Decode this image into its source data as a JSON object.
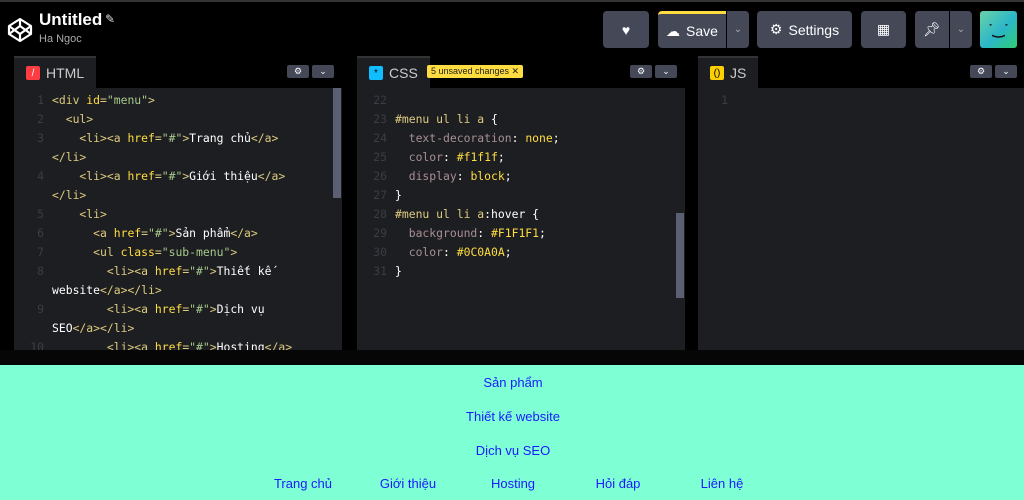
{
  "header": {
    "title": "Untitled",
    "author": "Ha Ngoc",
    "save_label": "Save",
    "settings_label": "Settings"
  },
  "icons": {
    "logo": "codepen-logo",
    "edit": "pencil-icon",
    "like": "heart-icon",
    "save": "cloud-icon",
    "settings": "gear-icon",
    "layout": "layout-icon",
    "pin": "pin-icon",
    "dropdown": "chevron-down-icon"
  },
  "colors": {
    "accent": "#ffdd40",
    "html": "#ff3c41",
    "css": "#0ebeff",
    "js": "#fcd000",
    "preview_bg": "#7fffd4",
    "link": "#1a1aff"
  },
  "html_panel": {
    "label": "HTML",
    "rows": [
      {
        "n": "1",
        "s": [
          [
            "tg",
            "<div "
          ],
          [
            "at",
            "id"
          ],
          [
            "tg",
            "="
          ],
          [
            "st",
            "\"menu\""
          ],
          [
            "tg",
            ">"
          ]
        ]
      },
      {
        "n": "2",
        "s": [
          [
            "tg",
            "  <ul>"
          ]
        ]
      },
      {
        "n": "3",
        "s": [
          [
            "tg",
            "    <li><a "
          ],
          [
            "at",
            "href"
          ],
          [
            "tg",
            "="
          ],
          [
            "st",
            "\"#\""
          ],
          [
            "tg",
            ">"
          ],
          [
            "tx",
            "Trang chủ"
          ],
          [
            "tg",
            "</a>"
          ]
        ]
      },
      {
        "n": "",
        "s": [
          [
            "tg",
            "</li>"
          ]
        ]
      },
      {
        "n": "4",
        "s": [
          [
            "tg",
            "    <li><a "
          ],
          [
            "at",
            "href"
          ],
          [
            "tg",
            "="
          ],
          [
            "st",
            "\"#\""
          ],
          [
            "tg",
            ">"
          ],
          [
            "tx",
            "Giới thiệu"
          ],
          [
            "tg",
            "</a>"
          ]
        ]
      },
      {
        "n": "",
        "s": [
          [
            "tg",
            "</li>"
          ]
        ]
      },
      {
        "n": "5",
        "s": [
          [
            "tg",
            "    <li>"
          ]
        ]
      },
      {
        "n": "6",
        "s": [
          [
            "tg",
            "      <a "
          ],
          [
            "at",
            "href"
          ],
          [
            "tg",
            "="
          ],
          [
            "st",
            "\"#\""
          ],
          [
            "tg",
            ">"
          ],
          [
            "tx",
            "Sản phẩm"
          ],
          [
            "tg",
            "</a>"
          ]
        ]
      },
      {
        "n": "7",
        "s": [
          [
            "tg",
            "      <ul "
          ],
          [
            "at",
            "class"
          ],
          [
            "tg",
            "="
          ],
          [
            "st",
            "\"sub-menu\""
          ],
          [
            "tg",
            ">"
          ]
        ]
      },
      {
        "n": "8",
        "s": [
          [
            "tg",
            "        <li><a "
          ],
          [
            "at",
            "href"
          ],
          [
            "tg",
            "="
          ],
          [
            "st",
            "\"#\""
          ],
          [
            "tg",
            ">"
          ],
          [
            "tx",
            "Thiết kế"
          ]
        ]
      },
      {
        "n": "",
        "s": [
          [
            "tx",
            "website"
          ],
          [
            "tg",
            "</a></li>"
          ]
        ]
      },
      {
        "n": "9",
        "s": [
          [
            "tg",
            "        <li><a "
          ],
          [
            "at",
            "href"
          ],
          [
            "tg",
            "="
          ],
          [
            "st",
            "\"#\""
          ],
          [
            "tg",
            ">"
          ],
          [
            "tx",
            "Dịch vụ"
          ]
        ]
      },
      {
        "n": "",
        "s": [
          [
            "tx",
            "SEO"
          ],
          [
            "tg",
            "</a></li>"
          ]
        ]
      },
      {
        "n": "10",
        "s": [
          [
            "tg",
            "        <li><a "
          ],
          [
            "at",
            "href"
          ],
          [
            "tg",
            "="
          ],
          [
            "st",
            "\"#\""
          ],
          [
            "tg",
            ">"
          ],
          [
            "tx",
            "Hosting"
          ],
          [
            "tg",
            "</a>"
          ]
        ]
      }
    ]
  },
  "css_panel": {
    "label": "CSS",
    "badge": "5 unsaved changes ✕",
    "rows": [
      {
        "n": "22",
        "s": []
      },
      {
        "n": "23",
        "s": [
          [
            "sel",
            "#menu ul li a "
          ],
          [
            "pu",
            "{"
          ]
        ]
      },
      {
        "n": "24",
        "s": [
          [
            "pr",
            "  text-decoration"
          ],
          [
            "pu",
            ": "
          ],
          [
            "vl",
            "none"
          ],
          [
            "pu",
            ";"
          ]
        ]
      },
      {
        "n": "25",
        "s": [
          [
            "pr",
            "  color"
          ],
          [
            "pu",
            ": "
          ],
          [
            "vl",
            "#f1f1f"
          ],
          [
            "pu",
            ";"
          ]
        ]
      },
      {
        "n": "26",
        "s": [
          [
            "pr",
            "  display"
          ],
          [
            "pu",
            ": "
          ],
          [
            "vl",
            "block"
          ],
          [
            "pu",
            ";"
          ]
        ]
      },
      {
        "n": "27",
        "s": [
          [
            "pu",
            "}"
          ]
        ]
      },
      {
        "n": "28",
        "s": [
          [
            "sel",
            "#menu ul li a"
          ],
          [
            "pu",
            ":hover {"
          ]
        ]
      },
      {
        "n": "29",
        "s": [
          [
            "pr",
            "  background"
          ],
          [
            "pu",
            ": "
          ],
          [
            "vl",
            "#F1F1F1"
          ],
          [
            "pu",
            ";"
          ]
        ]
      },
      {
        "n": "30",
        "s": [
          [
            "pr",
            "  color"
          ],
          [
            "pu",
            ": "
          ],
          [
            "vl",
            "#0C0A0A"
          ],
          [
            "pu",
            ";"
          ]
        ]
      },
      {
        "n": "31",
        "s": [
          [
            "pu",
            "}"
          ]
        ]
      }
    ]
  },
  "js_panel": {
    "label": "JS",
    "rows": [
      {
        "n": "1",
        "s": []
      }
    ]
  },
  "preview": {
    "links": [
      "Sản phẩm",
      "Thiết kế website",
      "Dịch vụ SEO",
      "Trang chủ",
      "Giới thiệu",
      "Hosting",
      "Hỏi đáp",
      "Liên hệ"
    ]
  }
}
